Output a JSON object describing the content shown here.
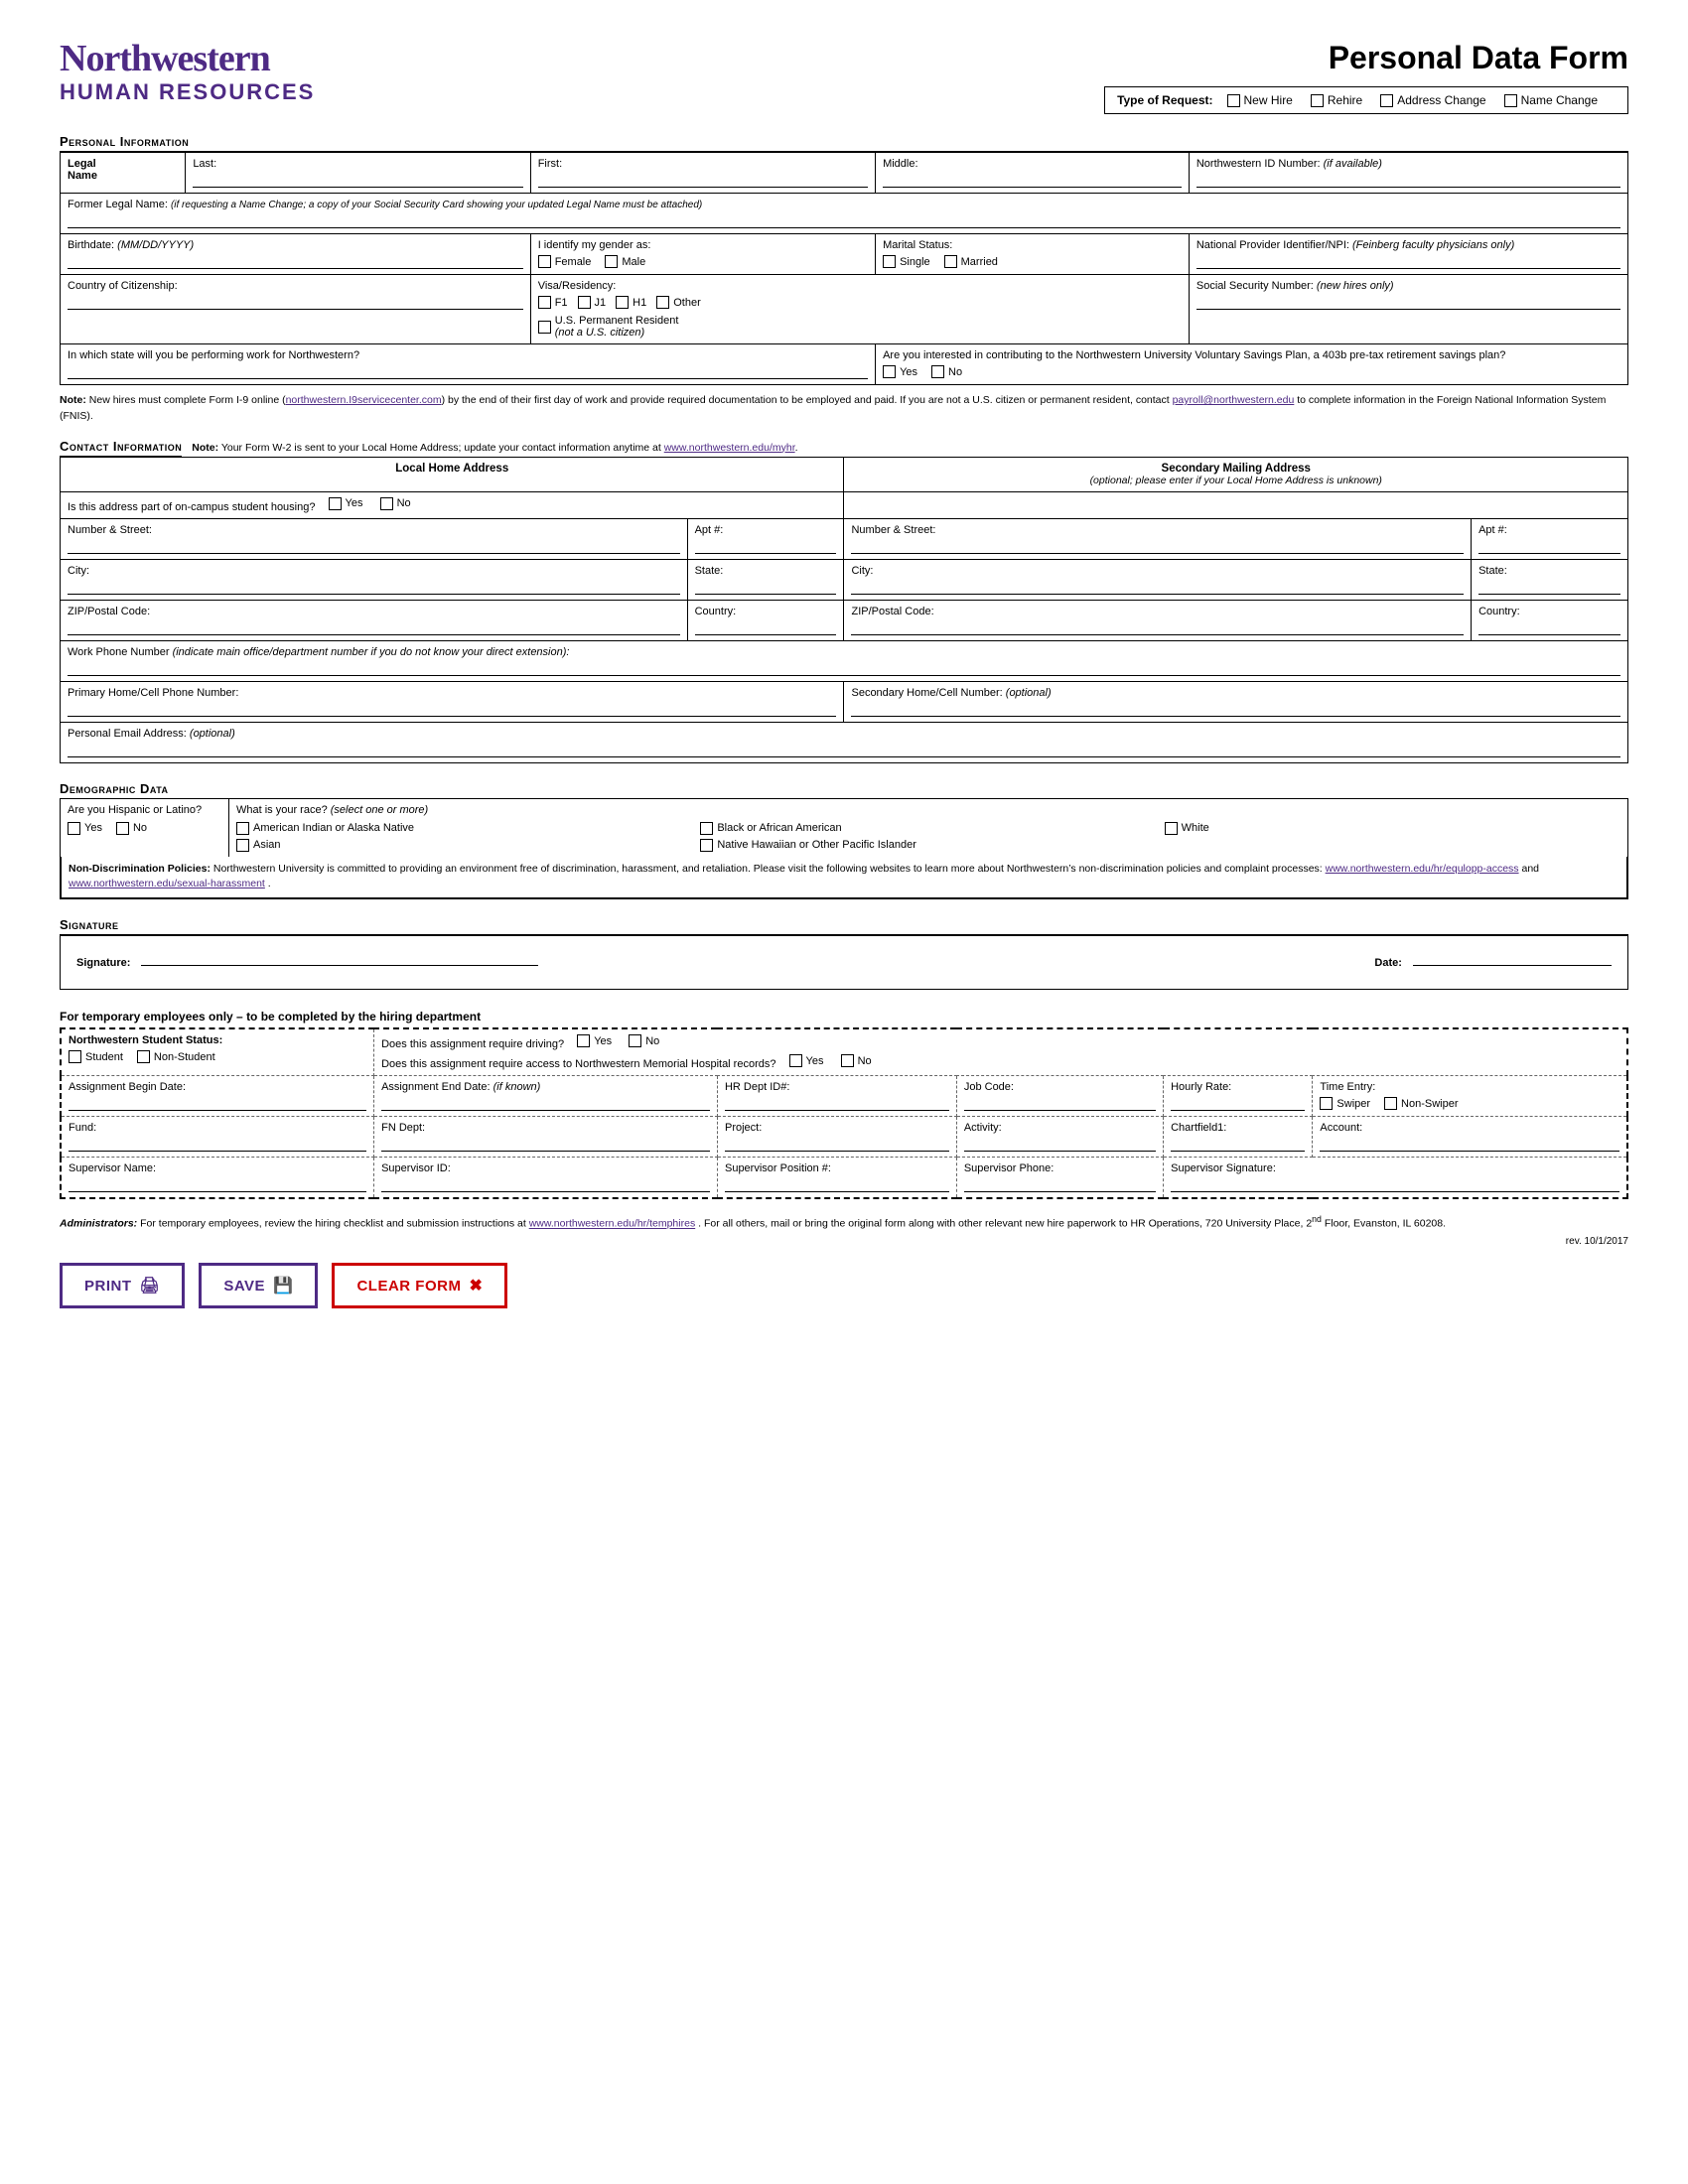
{
  "header": {
    "logo_name": "Northwestern",
    "logo_sub": "HUMAN RESOURCES",
    "form_title": "Personal Data Form",
    "type_of_request_label": "Type of Request:",
    "request_options": [
      "New Hire",
      "Rehire",
      "Address Change",
      "Name Change"
    ]
  },
  "sections": {
    "personal_info": {
      "title": "Personal Information",
      "fields": {
        "legal_name_label": "Legal Name",
        "last_label": "Last:",
        "first_label": "First:",
        "middle_label": "Middle:",
        "nwid_label": "Northwestern ID Number:",
        "nwid_note": "(if available)",
        "former_legal_label": "Former Legal Name:",
        "former_legal_note": "(if requesting a Name Change; a copy of your Social Security Card showing your updated Legal Name must be attached)",
        "birthdate_label": "Birthdate:",
        "birthdate_note": "(MM/DD/YYYY)",
        "gender_label": "I identify my gender as:",
        "gender_options": [
          "Female",
          "Male"
        ],
        "marital_label": "Marital Status:",
        "marital_options": [
          "Single",
          "Married"
        ],
        "npi_label": "National Provider Identifier/NPI:",
        "npi_note": "(Feinberg faculty physicians only)",
        "citizenship_label": "Country of Citizenship:",
        "visa_label": "Visa/Residency:",
        "visa_options": [
          "F1",
          "J1",
          "H1",
          "Other"
        ],
        "perm_resident_label": "U.S. Permanent Resident",
        "perm_resident_note": "(not a U.S. citizen)",
        "ssn_label": "Social Security Number:",
        "ssn_note": "(new hires only)",
        "state_work_label": "In which state will you be performing work for Northwestern?",
        "savings_label": "Are you interested in contributing to the Northwestern University Voluntary Savings Plan, a 403b pre-tax retirement savings plan?",
        "savings_options": [
          "Yes",
          "No"
        ],
        "note_label": "Note:",
        "note_text": "New hires must complete Form I-9 online (northwestern.I9servicecenter.com) by the end of their first day of work and provide required documentation to be employed and paid. If you are not a U.S. citizen or permanent resident, contact payroll@northwestern.edu to complete information in the Foreign National Information System (FNIS).",
        "note_link1": "northwestern.I9servicecenter.com",
        "note_link2": "payroll@northwestern.edu"
      }
    },
    "contact_info": {
      "title": "Contact Information",
      "note": "Note: Your Form W-2 is sent to your Local Home Address; update your contact information anytime at www.northwestern.edu/myhr.",
      "note_link": "www.northwestern.edu/myhr",
      "local_address_header": "Local Home Address",
      "local_campus_housing_label": "Is this address part of on-campus student housing?",
      "yes_label": "Yes",
      "no_label": "No",
      "number_street_label": "Number & Street:",
      "apt_label": "Apt #:",
      "city_label": "City:",
      "state_label": "State:",
      "zip_label": "ZIP/Postal Code:",
      "country_label": "Country:",
      "secondary_address_header": "Secondary Mailing Address",
      "secondary_address_note": "(optional; please enter if your Local Home Address is unknown)",
      "work_phone_label": "Work Phone Number",
      "work_phone_note": "(indicate main office/department number if you do not know your direct extension):",
      "primary_phone_label": "Primary Home/Cell Phone Number:",
      "secondary_phone_label": "Secondary Home/Cell Number:",
      "secondary_phone_note": "(optional)",
      "email_label": "Personal Email Address:",
      "email_note": "(optional)"
    },
    "demographic": {
      "title": "Demographic Data",
      "hispanic_label": "Are you Hispanic or Latino?",
      "hispanic_options": [
        "Yes",
        "No"
      ],
      "race_label": "What is your race?",
      "race_note": "(select one or more)",
      "race_options": [
        "American Indian or Alaska Native",
        "Black or African American",
        "White",
        "Asian",
        "Native Hawaiian or Other Pacific Islander"
      ],
      "non_disc_bold": "Non-Discrimination Policies:",
      "non_disc_text": " Northwestern University is committed to providing an environment free of discrimination, harassment, and retaliation. Please visit the following websites to learn more about Northwestern’s non-discrimination policies and complaint processes: ",
      "non_disc_link1": "www.northwestern.edu/hr/equlopp-access",
      "non_disc_and": " and",
      "non_disc_link2": "www.northwestern.edu/sexual-harassment",
      "non_disc_end": "."
    },
    "signature": {
      "title": "Signature",
      "sig_label": "Signature:",
      "date_label": "Date:"
    },
    "temp_section": {
      "title": "For temporary employees only – to be completed by the hiring department",
      "nw_student_status_label": "Northwestern Student Status:",
      "student_options": [
        "Student",
        "Non-Student"
      ],
      "driving_label": "Does this assignment require driving?",
      "driving_options": [
        "Yes",
        "No"
      ],
      "hospital_label": "Does this assignment require access to Northwestern Memorial Hospital records?",
      "hospital_options": [
        "Yes",
        "No"
      ],
      "assignment_begin_label": "Assignment Begin Date:",
      "assignment_end_label": "Assignment End Date:",
      "assignment_end_note": "(if known)",
      "hr_dept_label": "HR Dept ID#:",
      "job_code_label": "Job Code:",
      "hourly_rate_label": "Hourly Rate:",
      "time_entry_label": "Time Entry:",
      "swiper_options": [
        "Swiper",
        "Non-Swiper"
      ],
      "fund_label": "Fund:",
      "fn_dept_label": "FN Dept:",
      "project_label": "Project:",
      "activity_label": "Activity:",
      "chartfield1_label": "Chartfield1:",
      "account_label": "Account:",
      "supervisor_name_label": "Supervisor Name:",
      "supervisor_id_label": "Supervisor ID:",
      "supervisor_position_label": "Supervisor Position #:",
      "supervisor_phone_label": "Supervisor Phone:",
      "supervisor_sig_label": "Supervisor Signature:"
    },
    "footer": {
      "admin_bold": "Administrators:",
      "admin_text": " For temporary employees, review the hiring checklist and submission instructions at ",
      "admin_link": "www.northwestern.edu/hr/temphires",
      "admin_text2": ".  For all others, mail or bring the original form along with other relevant new hire paperwork to HR Operations, 720 University Place, 2",
      "admin_superscript": "nd",
      "admin_text3": " Floor, Evanston, IL 60208.",
      "rev": "rev. 10/1/2017"
    },
    "buttons": {
      "print": "PRINT",
      "save": "SAVE",
      "clear": "CLEAR FORM"
    }
  }
}
